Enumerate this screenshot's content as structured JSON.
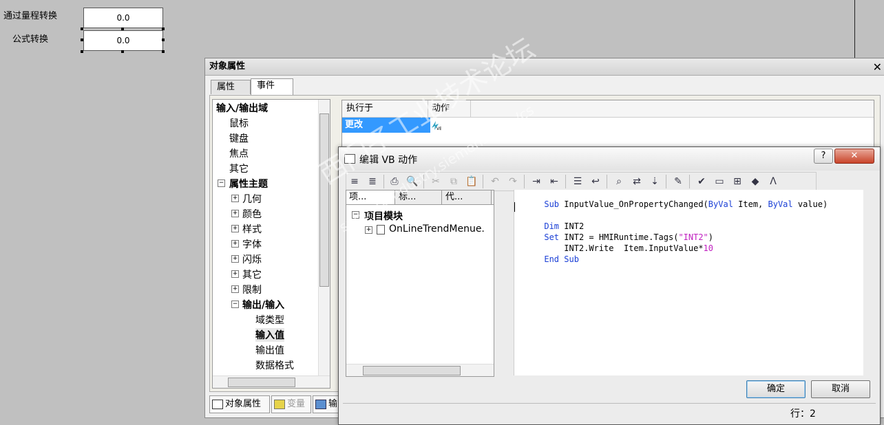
{
  "canvas": {
    "label1": "通过量程转换",
    "label2": "公式转换",
    "field1_value": "0.0",
    "field2_value": "0.0"
  },
  "objwin": {
    "title": "对象属性",
    "close": "✕",
    "tabs": [
      "属性",
      "事件"
    ],
    "tree": [
      {
        "label": "输入/输出域",
        "bold": true
      },
      {
        "label": "鼠标"
      },
      {
        "label": "键盘"
      },
      {
        "label": "焦点"
      },
      {
        "label": "其它"
      },
      {
        "label": "属性主题",
        "bold": true
      },
      {
        "label": "几何"
      },
      {
        "label": "颜色"
      },
      {
        "label": "样式"
      },
      {
        "label": "字体"
      },
      {
        "label": "闪烁"
      },
      {
        "label": "其它"
      },
      {
        "label": "限制"
      },
      {
        "label": "输出/输入",
        "bold": true
      },
      {
        "label": "域类型"
      },
      {
        "label": "输入值",
        "bold": true
      },
      {
        "label": "输出值"
      },
      {
        "label": "数据格式"
      }
    ],
    "grid": {
      "col1": "执行于",
      "col2": "动作",
      "row_label": "更改",
      "row_action_icon": "vb-icon"
    },
    "bottom_tabs": [
      "对象属性",
      "变量",
      "输"
    ]
  },
  "vb": {
    "title": "编辑 VB 动作",
    "help": "?",
    "close": "✕",
    "project_tabs": [
      "项...",
      "标...",
      "代..."
    ],
    "tree_root": "项目模块",
    "tree_child": "OnLineTrendMenue.",
    "ok": "确定",
    "cancel": "取消",
    "status_row": "行：2",
    "code": {
      "l1_kw1": "Sub",
      "l1_name": " InputValue_OnPropertyChanged(",
      "l1_kw2": "ByVal",
      "l1_mid": " Item, ",
      "l1_kw3": "ByVal",
      "l1_end": " value)",
      "l3_kw": "Dim",
      "l3_rest": " INT2",
      "l4_kw": "Set",
      "l4_mid": " INT2 = HMIRuntime.Tags(",
      "l4_str": "\"INT2\"",
      "l4_end": ")",
      "l5": "    INT2.Write  Item.InputValue*",
      "l5_num": "10",
      "l6_kw1": "End",
      "l6_kw2": "Sub"
    }
  },
  "watermark": {
    "line1": "西门子工业技术论坛",
    "line2": "support.industry.siemens.com/cs"
  }
}
